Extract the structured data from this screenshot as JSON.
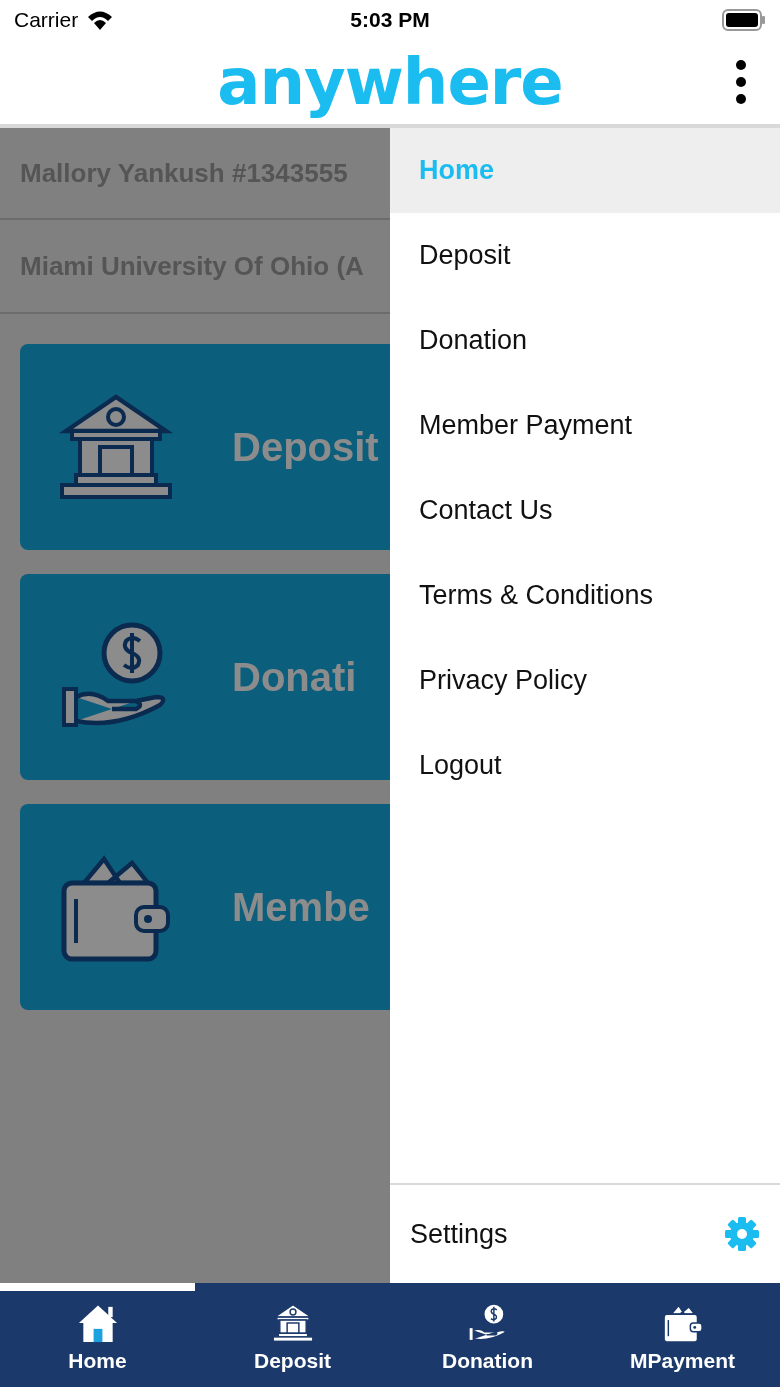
{
  "status_bar": {
    "carrier": "Carrier",
    "time": "5:03 PM"
  },
  "header": {
    "logo": "anywhere"
  },
  "account": {
    "member": "Mallory Yankush #1343555",
    "organization": "Miami University Of Ohio (A"
  },
  "cards": [
    {
      "kind": "bank",
      "label": "Deposit"
    },
    {
      "kind": "donation",
      "label": "Donati"
    },
    {
      "kind": "wallet",
      "label": "Membe"
    }
  ],
  "drawer": {
    "items": [
      {
        "label": "Home",
        "selected": true
      },
      {
        "label": "Deposit",
        "selected": false
      },
      {
        "label": "Donation",
        "selected": false
      },
      {
        "label": "Member Payment",
        "selected": false
      },
      {
        "label": "Contact Us",
        "selected": false
      },
      {
        "label": "Terms & Conditions",
        "selected": false
      },
      {
        "label": "Privacy Policy",
        "selected": false
      },
      {
        "label": "Logout",
        "selected": false
      }
    ],
    "settings": "Settings"
  },
  "tab_bar": [
    {
      "kind": "home",
      "label": "Home",
      "selected": true
    },
    {
      "kind": "bank",
      "label": "Deposit",
      "selected": false
    },
    {
      "kind": "donation",
      "label": "Donation",
      "selected": false
    },
    {
      "kind": "wallet",
      "label": "MPayment",
      "selected": false
    }
  ]
}
